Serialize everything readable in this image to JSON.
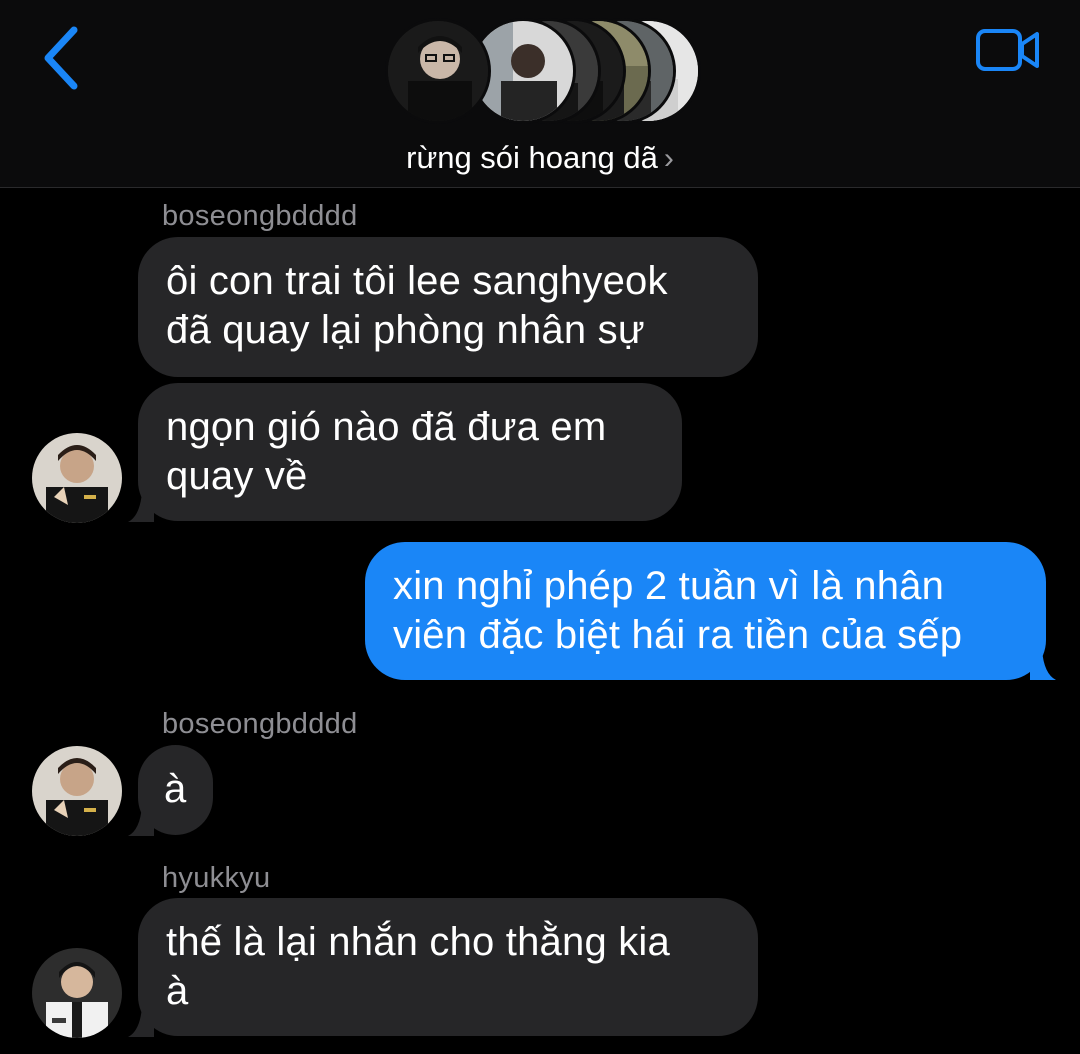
{
  "header": {
    "group_name": "rừng sói hoang dã",
    "chevron": "›",
    "back_icon": "chevron-left-icon",
    "video_icon": "video-camera-icon",
    "accent": "#1a86f7"
  },
  "messages": [
    {
      "sender": "boseongbdddd",
      "text": "ôi con trai tôi lee sanghyeok\nđã quay lại phòng nhân sự",
      "direction": "incoming"
    },
    {
      "sender": "",
      "text": "ngọn gió nào đã đưa em\nquay về",
      "direction": "incoming"
    },
    {
      "sender": "",
      "text": "xin nghỉ phép 2 tuần vì là nhân\nviên đặc biệt hái ra tiền của sếp",
      "direction": "outgoing"
    },
    {
      "sender": "boseongbdddd",
      "text": "à",
      "direction": "incoming"
    },
    {
      "sender": "hyukkyu",
      "text": "thế là lại nhắn cho thằng kia\nà",
      "direction": "incoming"
    }
  ],
  "colors": {
    "background": "#000000",
    "incoming_bubble": "#262628",
    "outgoing_bubble": "#1a86f7",
    "sender_name": "#8e8e93"
  }
}
